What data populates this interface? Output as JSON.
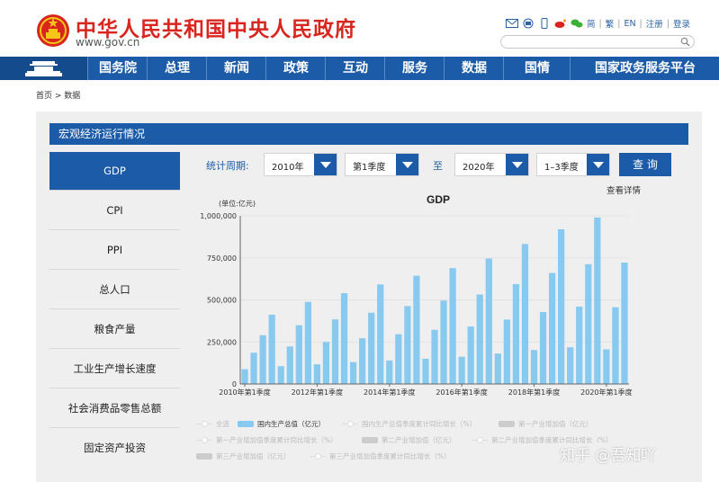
{
  "header": {
    "site_title": "中华人民共和国中央人民政府",
    "site_url": "www.gov.cn",
    "links": [
      "简",
      "繁",
      "EN",
      "注册",
      "登录"
    ],
    "icons": [
      "mail-icon",
      "rss-icon",
      "mobile-icon",
      "weibo-icon",
      "wechat-icon"
    ]
  },
  "nav": {
    "items": [
      "国务院",
      "总理",
      "新闻",
      "政策",
      "互动",
      "服务",
      "数据",
      "国情",
      "国家政务服务平台"
    ]
  },
  "breadcrumb": "首页 > 数据",
  "panel": {
    "title": "宏观经济运行情况"
  },
  "sidebar": {
    "items": [
      "GDP",
      "CPI",
      "PPI",
      "总人口",
      "粮食产量",
      "工业生产增长速度",
      "社会消费品零售总额",
      "固定资产投资"
    ],
    "active": "GDP"
  },
  "filters": {
    "label": "统计周期:",
    "start_year": "2010年",
    "start_quarter": "第1季度",
    "to_label": "至",
    "end_year": "2020年",
    "end_quarter": "1–3季度",
    "query_button": "查 询",
    "detail_link": "查看详情"
  },
  "chart_data": {
    "type": "bar",
    "title": "GDP",
    "unit_label": "(单位:亿元)",
    "ylim": [
      0,
      1000000
    ],
    "yticks": [
      "0",
      "250,000",
      "500,000",
      "750,000",
      "1,000,000"
    ],
    "xtick_labels": [
      "2010年第1季度",
      "2012年第1季度",
      "2014年第1季度",
      "2016年第1季度",
      "2018年第1季度",
      "2020年第1季度"
    ],
    "grid": true,
    "categories": [
      "2010Q1",
      "2010Q2",
      "2010Q3",
      "2010Q4",
      "2011Q1",
      "2011Q2",
      "2011Q3",
      "2011Q4",
      "2012Q1",
      "2012Q2",
      "2012Q3",
      "2012Q4",
      "2013Q1",
      "2013Q2",
      "2013Q3",
      "2013Q4",
      "2014Q1",
      "2014Q2",
      "2014Q3",
      "2014Q4",
      "2015Q1",
      "2015Q2",
      "2015Q3",
      "2015Q4",
      "2016Q1",
      "2016Q2",
      "2016Q3",
      "2016Q4",
      "2017Q1",
      "2017Q2",
      "2017Q3",
      "2017Q4",
      "2018Q1",
      "2018Q2",
      "2018Q3",
      "2018Q4",
      "2019Q1",
      "2019Q2",
      "2019Q3",
      "2019Q4",
      "2020Q1",
      "2020Q2",
      "2020Q3"
    ],
    "series": [
      {
        "name": "国内生产总值（亿元）",
        "color": "#88c9f0",
        "values": [
          88000,
          186000,
          290000,
          412000,
          106000,
          223000,
          349000,
          488000,
          117000,
          250000,
          384000,
          540000,
          130000,
          272000,
          424000,
          592000,
          140000,
          296000,
          463000,
          644000,
          150000,
          322000,
          496000,
          689000,
          162000,
          342000,
          532000,
          746000,
          181000,
          383000,
          594000,
          832000,
          202000,
          428000,
          660000,
          920000,
          218000,
          460000,
          712000,
          990000,
          206000,
          456000,
          722000
        ]
      }
    ]
  },
  "legend": {
    "items": [
      {
        "label": "全选",
        "kind": "line",
        "on": false
      },
      {
        "label": "国内生产总值（亿元）",
        "kind": "box",
        "on": true
      },
      {
        "label": "国内生产总值季度累计同比增长（%）",
        "kind": "line",
        "on": false
      },
      {
        "label": "第一产业增加值（亿元）",
        "kind": "box",
        "on": false
      },
      {
        "label": "第一产业增加值季度累计同比增长（%）",
        "kind": "line",
        "on": false
      },
      {
        "label": "第二产业增加值（亿元）",
        "kind": "box",
        "on": false
      },
      {
        "label": "第二产业增加值季度累计同比增长（%）",
        "kind": "line",
        "on": false
      },
      {
        "label": "第三产业增加值（亿元）",
        "kind": "box",
        "on": false
      },
      {
        "label": "第三产业增加值季度累计同比增长（%）",
        "kind": "line",
        "on": false
      }
    ]
  },
  "watermark": "知乎 @吾知吖",
  "colors": {
    "brand_red": "#d8261f",
    "nav_blue": "#1b5ba7",
    "bar_blue": "#88c9f0"
  }
}
